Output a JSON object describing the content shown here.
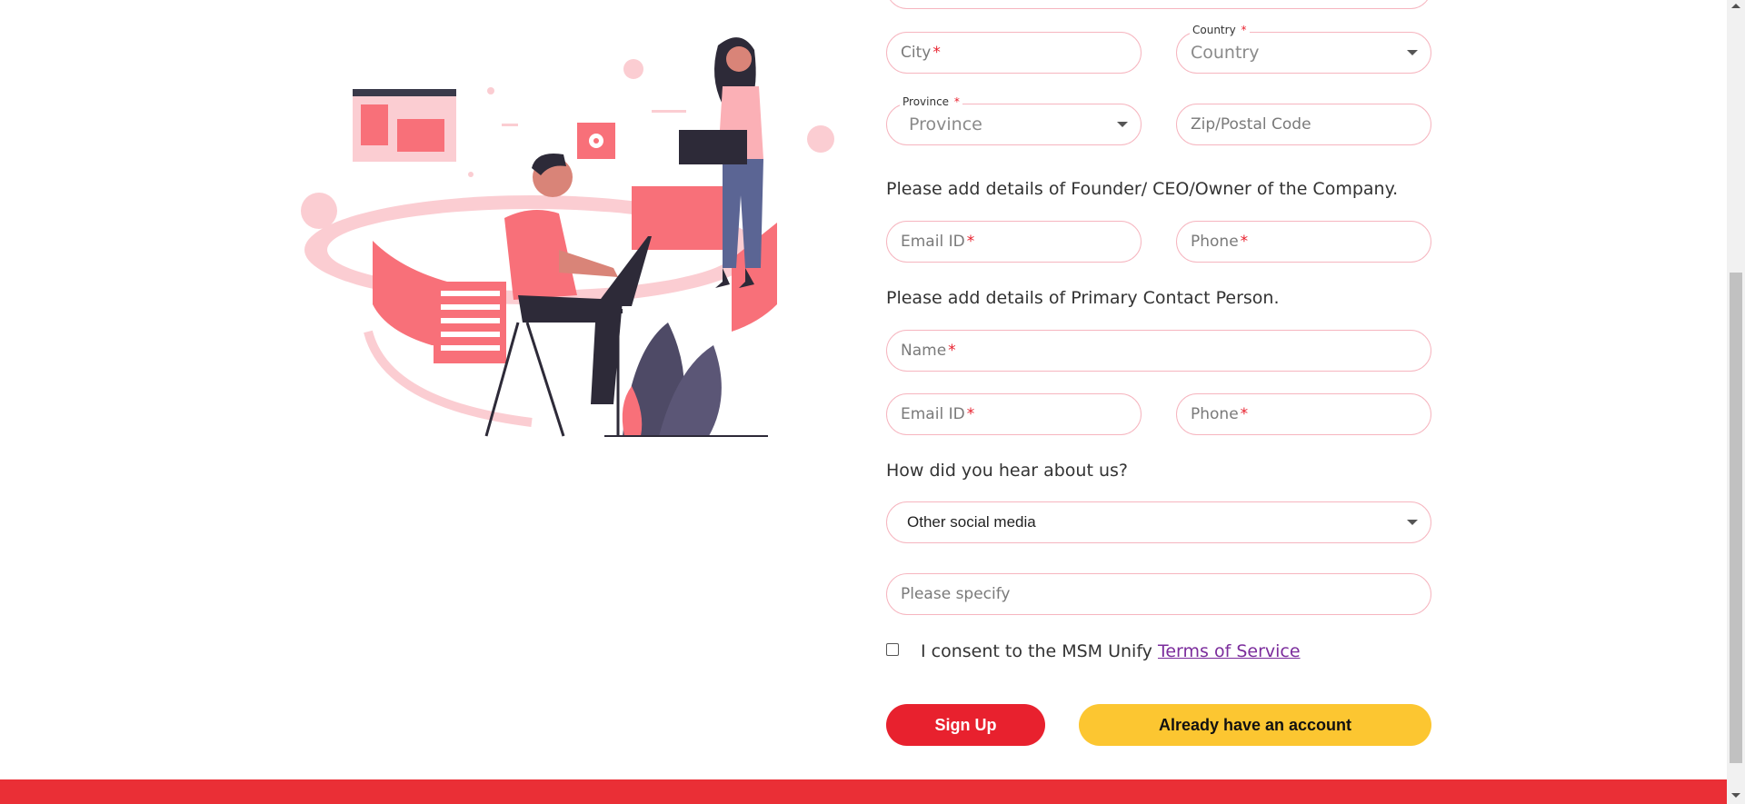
{
  "form": {
    "city": {
      "placeholder": "City",
      "required_mark": "*"
    },
    "country": {
      "label": "Country",
      "required_mark": "*",
      "value": "Country"
    },
    "province": {
      "label": "Province",
      "required_mark": "*",
      "value": "Province"
    },
    "zip": {
      "placeholder": "Zip/Postal Code"
    },
    "founder_heading": "Please add details of Founder/ CEO/Owner of the Company.",
    "founder_email": {
      "placeholder": "Email ID",
      "required_mark": "*"
    },
    "founder_phone": {
      "placeholder": "Phone",
      "required_mark": "*"
    },
    "contact_heading": "Please add details of Primary Contact Person.",
    "contact_name": {
      "placeholder": "Name",
      "required_mark": "*"
    },
    "contact_email": {
      "placeholder": "Email ID",
      "required_mark": "*"
    },
    "contact_phone": {
      "placeholder": "Phone",
      "required_mark": "*"
    },
    "hear_heading": "How did you hear about us?",
    "hear_select": {
      "value": "Other social media"
    },
    "specify": {
      "placeholder": "Please specify"
    },
    "consent": {
      "text": "I consent to the MSM Unify ",
      "link": "Terms of Service",
      "checked": false
    }
  },
  "buttons": {
    "signup": "Sign Up",
    "login": "Already have an account"
  },
  "colors": {
    "accent_red": "#e8212e",
    "accent_yellow": "#fcc631",
    "field_border": "#f6b5bf",
    "link_purple": "#7b2c9c",
    "footer_red": "#ea2f36"
  }
}
